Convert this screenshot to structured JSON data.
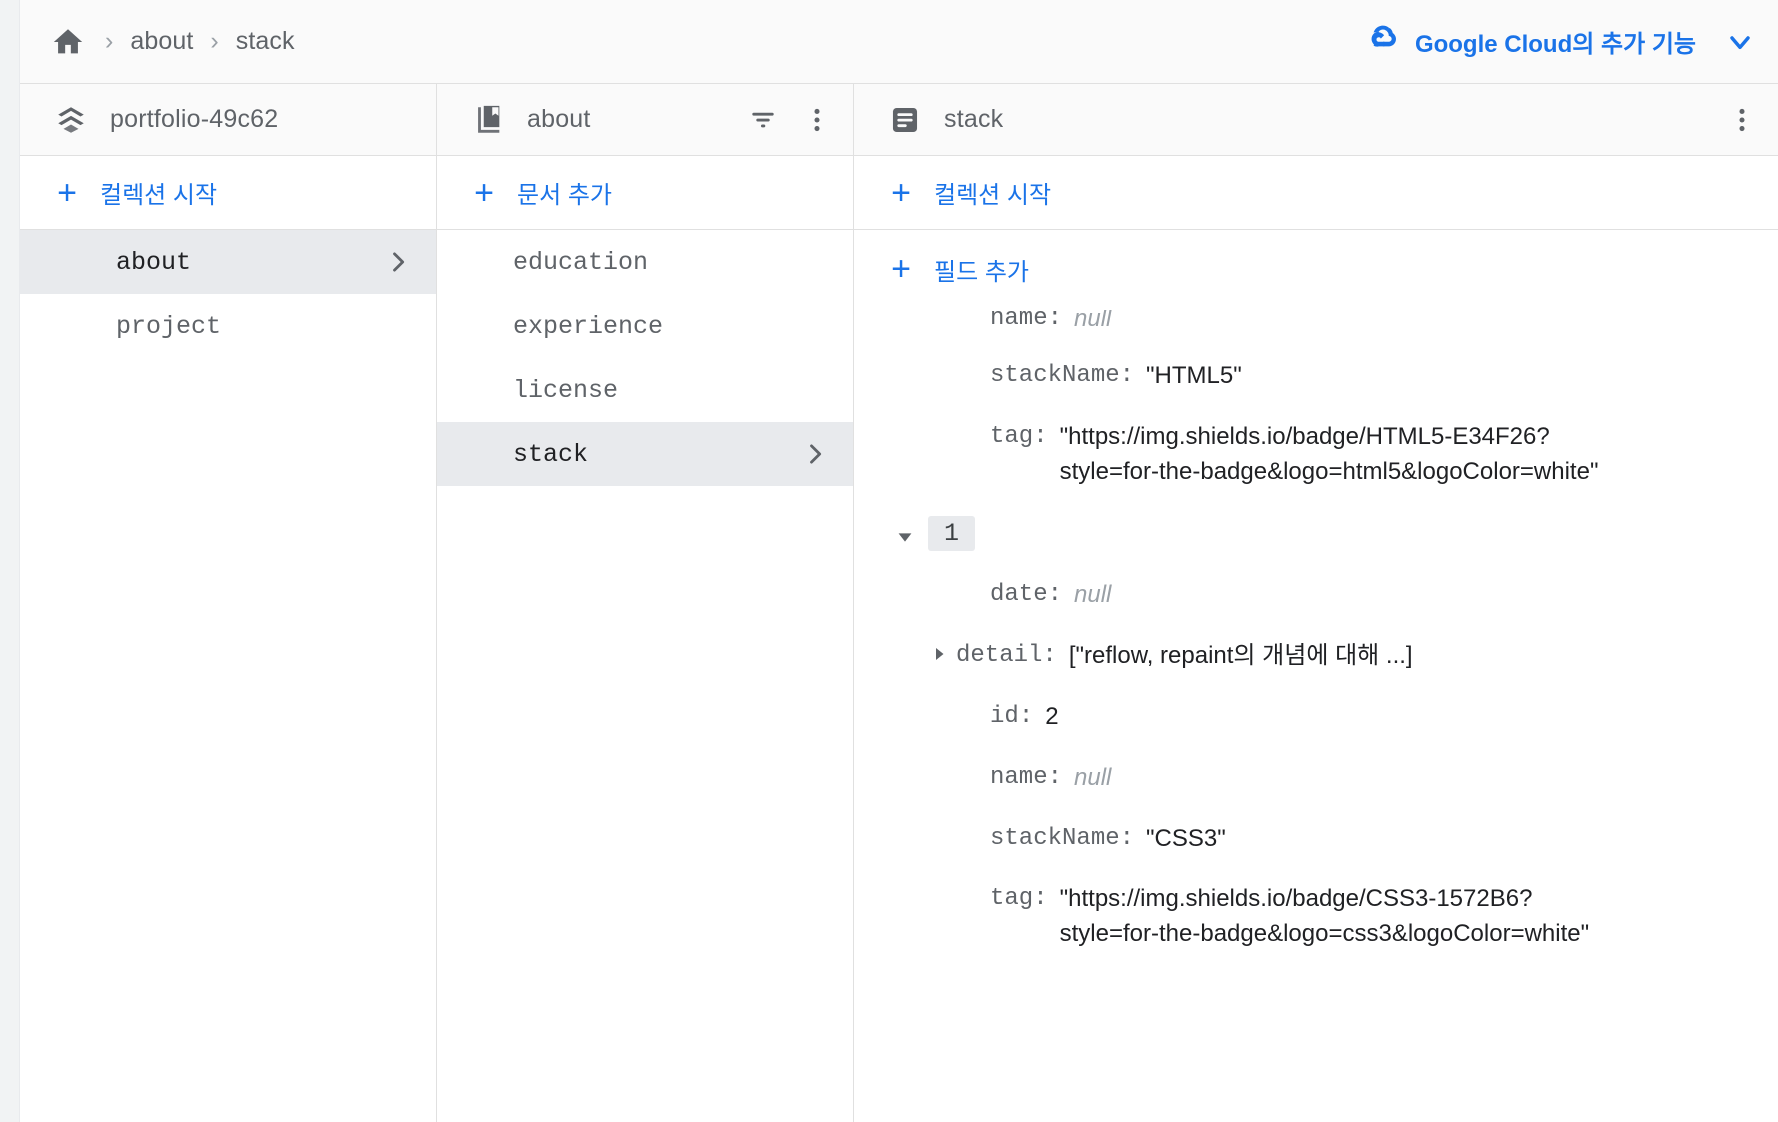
{
  "topbar": {
    "home_icon": "home-icon",
    "separator": "›",
    "crumbs": [
      "about",
      "stack"
    ],
    "cloud_link_label": "Google Cloud의 추가 기능",
    "cloud_icon": "google-cloud-icon",
    "chevron_icon": "chevron-down-icon",
    "link_color": "#1a73e8"
  },
  "panes": {
    "project": {
      "icon": "firebase-database-icon",
      "title": "portfolio-49c62",
      "add_label": "컬렉션 시작",
      "add_icon": "plus-icon",
      "items": [
        {
          "label": "about",
          "selected": true,
          "chevron": "chevron-right-icon"
        },
        {
          "label": "project",
          "selected": false,
          "chevron": ""
        }
      ]
    },
    "collection": {
      "icon": "collection-book-icon",
      "title": "about",
      "filter_icon": "filter-icon",
      "menu_icon": "more-vert-icon",
      "add_label": "문서 추가",
      "add_icon": "plus-icon",
      "items": [
        {
          "label": "education",
          "selected": false,
          "chevron": ""
        },
        {
          "label": "experience",
          "selected": false,
          "chevron": ""
        },
        {
          "label": "license",
          "selected": false,
          "chevron": ""
        },
        {
          "label": "stack",
          "selected": true,
          "chevron": "chevron-right-icon"
        }
      ]
    },
    "document": {
      "icon": "document-icon",
      "title": "stack",
      "menu_icon": "more-vert-icon",
      "add_collection_label": "컬렉션 시작",
      "add_field_label": "필드 추가",
      "add_icon": "plus-icon",
      "fields": [
        {
          "key": "name",
          "colon": ":",
          "value": "null",
          "kind": "null",
          "clipped": true
        },
        {
          "key": "stackName",
          "colon": ":",
          "value": "\"HTML5\"",
          "kind": "string"
        },
        {
          "key": "tag",
          "colon": ":",
          "value": "\"https://img.shields.io/badge/HTML5-E34F26?style=for-the-badge&logo=html5&logoColor=white\"",
          "kind": "string"
        }
      ],
      "array_index": {
        "label": "1",
        "expand_icon": "triangle-down-icon",
        "fields": [
          {
            "key": "date",
            "colon": ":",
            "value": "null",
            "kind": "null",
            "expandable": false
          },
          {
            "key": "detail",
            "colon": ":",
            "value": "[\"reflow, repaint의 개념에 대해 ...]",
            "kind": "array",
            "expandable": true,
            "expand_icon": "triangle-right-icon"
          },
          {
            "key": "id",
            "colon": ":",
            "value": "2",
            "kind": "number",
            "expandable": false
          },
          {
            "key": "name",
            "colon": ":",
            "value": "null",
            "kind": "null",
            "expandable": false
          },
          {
            "key": "stackName",
            "colon": ":",
            "value": "\"CSS3\"",
            "kind": "string",
            "expandable": false
          },
          {
            "key": "tag",
            "colon": ":",
            "value": "\"https://img.shields.io/badge/CSS3-1572B6?style=for-the-badge&logo=css3&logoColor=white\"",
            "kind": "string",
            "expandable": false
          }
        ]
      }
    }
  }
}
